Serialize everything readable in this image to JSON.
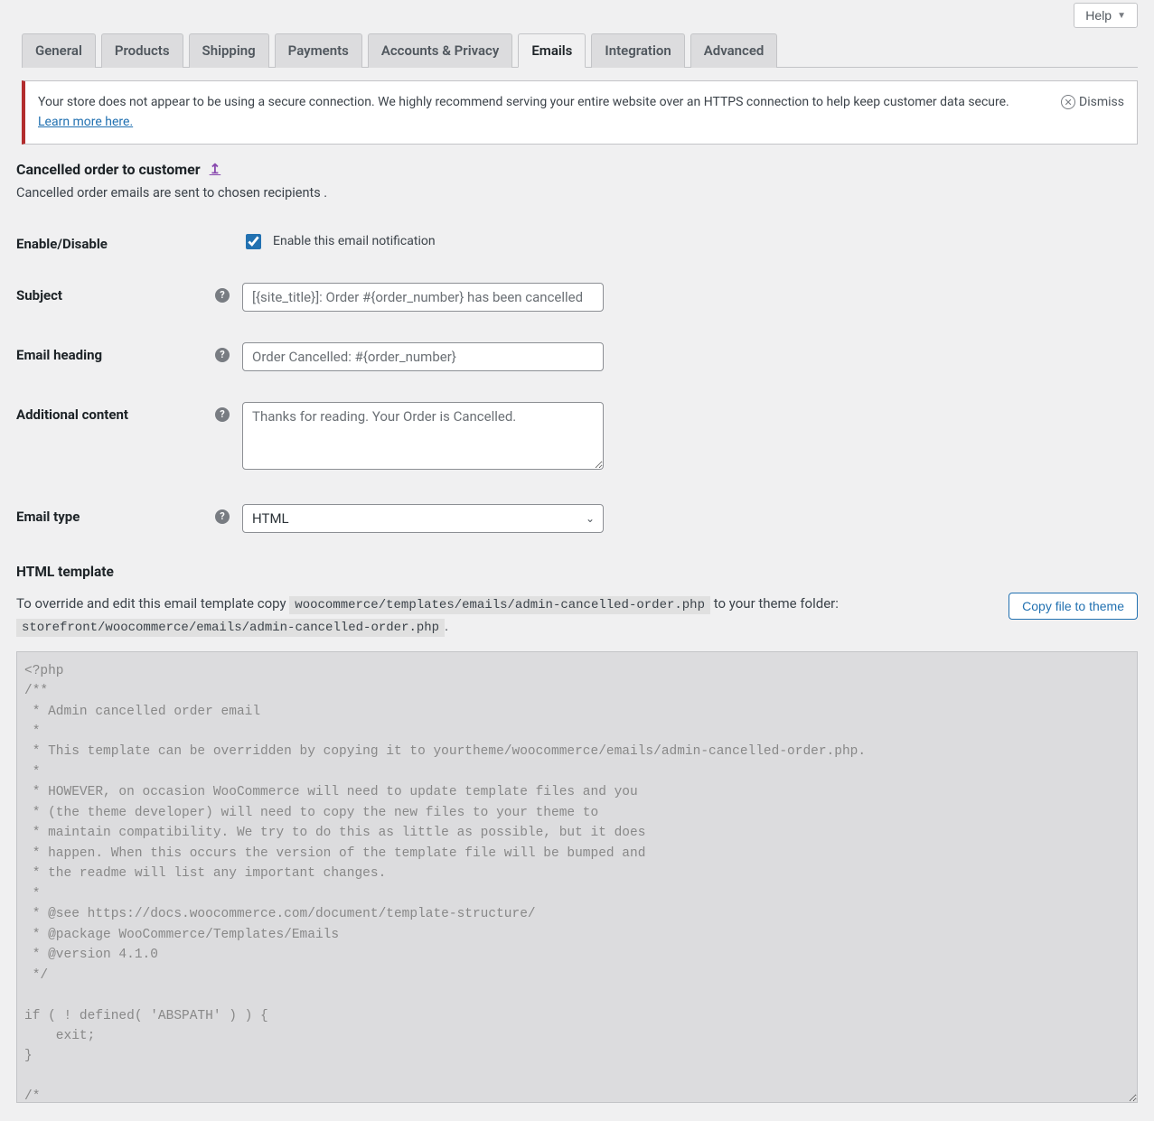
{
  "help_button": "Help",
  "tabs": [
    "General",
    "Products",
    "Shipping",
    "Payments",
    "Accounts & Privacy",
    "Emails",
    "Integration",
    "Advanced"
  ],
  "active_tab_index": 5,
  "notice": {
    "text": "Your store does not appear to be using a secure connection. We highly recommend serving your entire website over an HTTPS connection to help keep customer data secure. ",
    "link": "Learn more here.",
    "dismiss": "Dismiss"
  },
  "page": {
    "title": "Cancelled order to customer",
    "back_icon": "↥",
    "description": "Cancelled order emails are sent to chosen recipients ."
  },
  "fields": {
    "enable_label": "Enable/Disable",
    "enable_checkbox_label": "Enable this email notification",
    "enable_checked": true,
    "subject_label": "Subject",
    "subject_placeholder": "[{site_title}]: Order #{order_number} has been cancelled",
    "subject_value": "",
    "heading_label": "Email heading",
    "heading_placeholder": "Order Cancelled: #{order_number}",
    "heading_value": "",
    "additional_label": "Additional content",
    "additional_placeholder": "Thanks for reading. Your Order is Cancelled.",
    "additional_value": "",
    "type_label": "Email type",
    "type_value": "HTML"
  },
  "template": {
    "heading": "HTML template",
    "intro_1": "To override and edit this email template copy ",
    "path_src": "woocommerce/templates/emails/admin-cancelled-order.php",
    "intro_2": " to your theme folder: ",
    "path_dst": "storefront/woocommerce/emails/admin-cancelled-order.php",
    "dot": ".",
    "copy_button": "Copy file to theme",
    "code": "<?php\n/**\n * Admin cancelled order email\n *\n * This template can be overridden by copying it to yourtheme/woocommerce/emails/admin-cancelled-order.php.\n *\n * HOWEVER, on occasion WooCommerce will need to update template files and you\n * (the theme developer) will need to copy the new files to your theme to\n * maintain compatibility. We try to do this as little as possible, but it does\n * happen. When this occurs the version of the template file will be bumped and\n * the readme will list any important changes.\n *\n * @see https://docs.woocommerce.com/document/template-structure/\n * @package WooCommerce/Templates/Emails\n * @version 4.1.0\n */\n\nif ( ! defined( 'ABSPATH' ) ) {\n    exit;\n}\n\n/*\n * @hooked WC_Emails::email_header() Output the email header\n*/\ndo_action( 'woocommerce_email_header', $email_heading, $email ); ?>\n\n<?php /* translators: %1$s: Order number, %2$s: Customer full name.  */ ?>"
  }
}
